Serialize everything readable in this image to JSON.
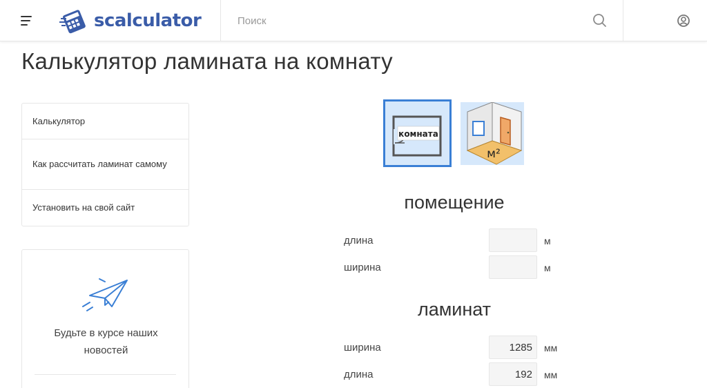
{
  "header": {
    "logo_text": "scalculator",
    "search_placeholder": "Поиск"
  },
  "page": {
    "title": "Калькулятор ламината на комнату"
  },
  "sidebar": {
    "items": [
      {
        "label": "Калькулятор"
      },
      {
        "label": "Как рассчитать ламинат самому"
      },
      {
        "label": "Установить на свой сайт"
      }
    ]
  },
  "subscribe": {
    "text": "Будьте в курсе наших новостей"
  },
  "modes": {
    "room_label": "комната",
    "area_label": "м²",
    "selected": "room"
  },
  "room": {
    "title": "помещение",
    "fields": [
      {
        "label": "длина",
        "value": "",
        "unit": "м"
      },
      {
        "label": "ширина",
        "value": "",
        "unit": "м"
      }
    ]
  },
  "laminate": {
    "title": "ламинат",
    "fields": [
      {
        "label": "ширина",
        "value": "1285",
        "unit": "мм"
      },
      {
        "label": "длина",
        "value": "192",
        "unit": "мм"
      }
    ]
  },
  "colors": {
    "brand": "#3a5ca8",
    "accent": "#3a7fd5",
    "mode_bg": "#d6e8fb"
  }
}
